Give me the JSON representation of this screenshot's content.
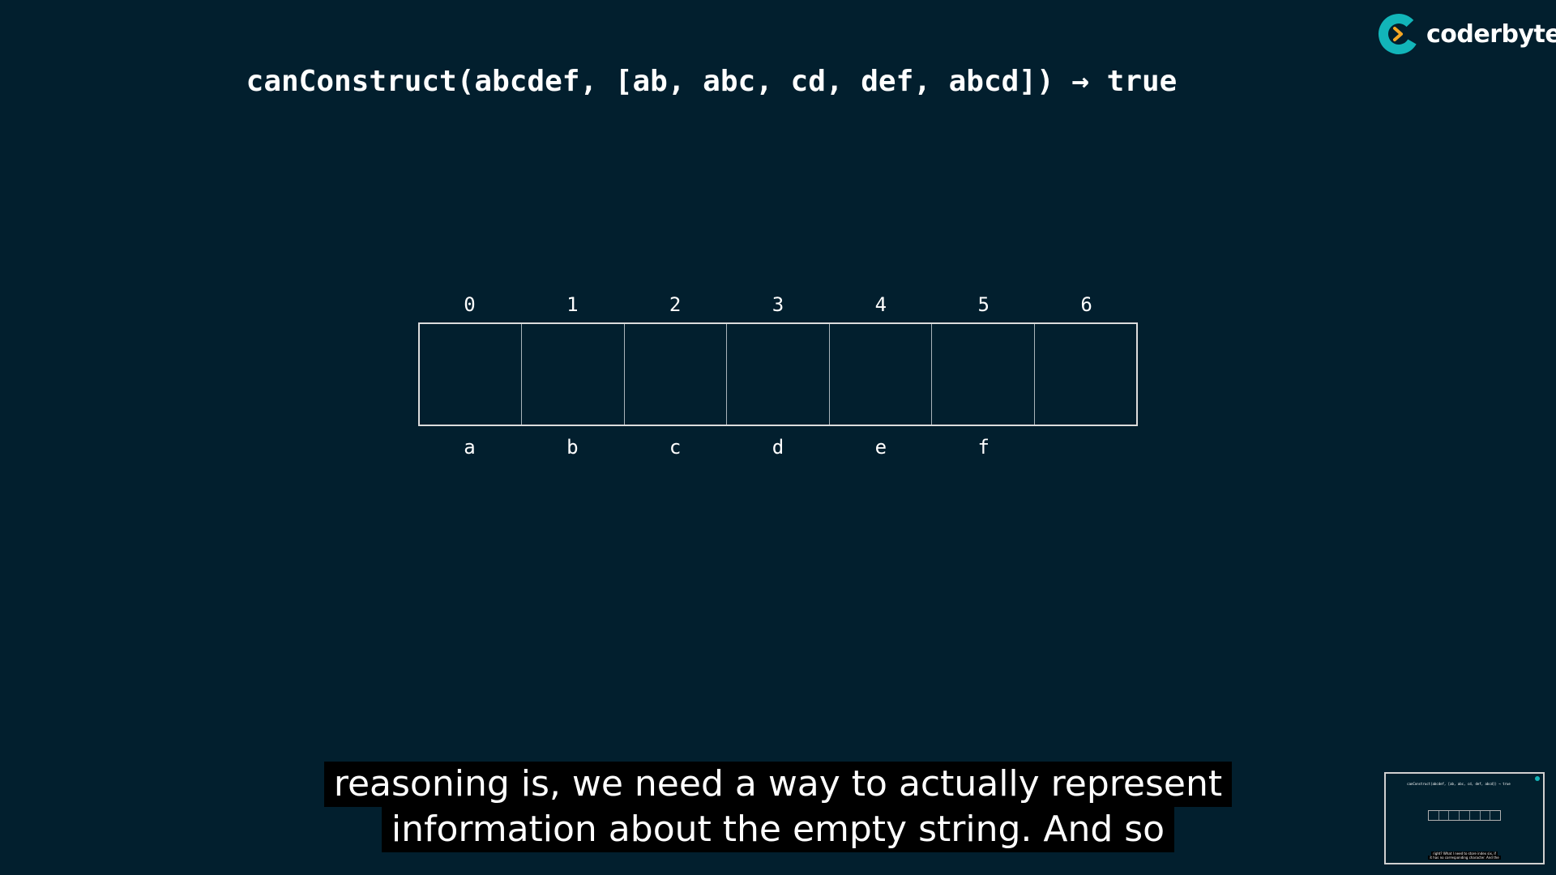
{
  "title": "canConstruct(abcdef, [ab, abc, cd, def, abcd]) → true",
  "logo": {
    "text": "coderbyte",
    "icon": "coderbyte-logo-icon",
    "colors": {
      "ring": "#12b5b9",
      "chevron": "#f5a623"
    }
  },
  "table": {
    "indices": [
      "0",
      "1",
      "2",
      "3",
      "4",
      "5",
      "6"
    ],
    "chars": [
      "a",
      "b",
      "c",
      "d",
      "e",
      "f",
      ""
    ],
    "cells": [
      "",
      "",
      "",
      "",
      "",
      "",
      ""
    ]
  },
  "subtitle": {
    "line1": "reasoning is, we need a way to actually represent",
    "line2": "information about the empty string. And so"
  },
  "thumbnail": {
    "title": "canConstruct(abcdef, [ab, abc, cd, def, abcd]) → true",
    "line1": "right? What I need to store index six, if",
    "line2": "it has no corresponding character. And the"
  },
  "colors": {
    "background": "#021f2e",
    "text": "#ffffff",
    "subtitle_bg": "#000000",
    "table_border": "#dcdcdc"
  }
}
